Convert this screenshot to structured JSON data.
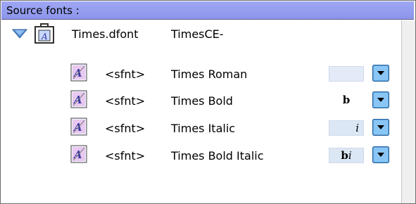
{
  "header": {
    "title": "Source fonts :"
  },
  "suitcase": {
    "filename": "Times.dfont",
    "family": "TimesCE-"
  },
  "fonts": [
    {
      "type": "<sfnt>",
      "name": "Times Roman",
      "style_bold": "",
      "style_italic": ""
    },
    {
      "type": "<sfnt>",
      "name": "Times Bold",
      "style_bold": "b",
      "style_italic": ""
    },
    {
      "type": "<sfnt>",
      "name": "Times Italic",
      "style_bold": "",
      "style_italic": "i"
    },
    {
      "type": "<sfnt>",
      "name": "Times Bold Italic",
      "style_bold": "b",
      "style_italic": "i"
    }
  ],
  "colors": {
    "header": "#9fa7f4",
    "dropdown": "#5aa7e8",
    "style_box": "#dbe7f5"
  }
}
